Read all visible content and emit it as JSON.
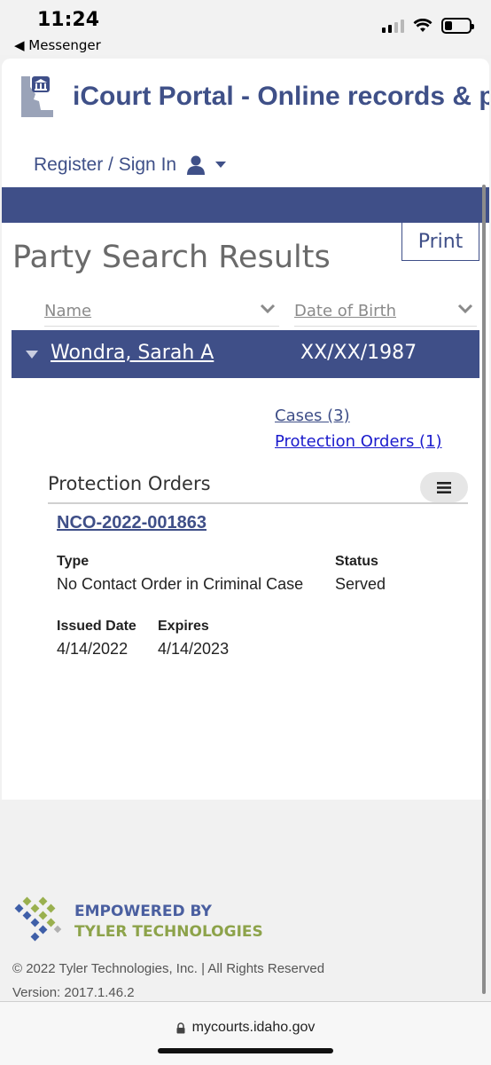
{
  "status_bar": {
    "time": "11:24",
    "back_app": "◀ Messenger"
  },
  "header": {
    "portal_title": "iCourt Portal - Online records & p",
    "signin_label": "Register / Sign In"
  },
  "print_label": "Print",
  "page_title": "Party Search Results",
  "table": {
    "columns": [
      "Name",
      "Date of Birth"
    ],
    "row": {
      "name": "Wondra, Sarah A",
      "dob": "XX/XX/1987"
    }
  },
  "links": {
    "cases": "Cases (3)",
    "protection_orders": "Protection Orders (1)"
  },
  "protection_orders": {
    "section_title": "Protection Orders",
    "case_number": "NCO-2022-001863",
    "type_label": "Type",
    "type_value": "No Contact Order in Criminal Case",
    "status_label": "Status",
    "status_value": "Served",
    "issued_label": "Issued Date",
    "issued_value": "4/14/2022",
    "expires_label": "Expires",
    "expires_value": "4/14/2023"
  },
  "footer": {
    "tyler_line1": "EMPOWERED BY",
    "tyler_line2": "TYLER TECHNOLOGIES",
    "copyright": "© 2022 Tyler Technologies, Inc. | All Rights Reserved",
    "version": "Version: 2017.1.46.2"
  },
  "url_bar": {
    "url": "mycourts.idaho.gov"
  },
  "colors": {
    "brand": "#3f4f88",
    "link_blue": "#1a1acc",
    "tyler_green": "#8da34a"
  },
  "icons": [
    "idaho-courthouse-logo-icon",
    "user-icon",
    "caret-down-icon",
    "chevron-down-icon",
    "triangle-down-icon",
    "hamburger-menu-icon",
    "tyler-logo-icon",
    "lock-icon",
    "signal-icon",
    "wifi-icon",
    "battery-icon"
  ]
}
